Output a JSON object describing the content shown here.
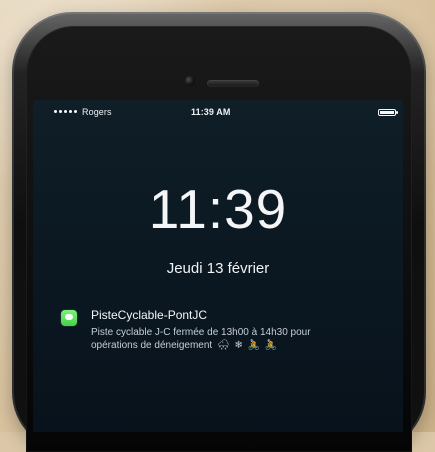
{
  "status_bar": {
    "carrier": "Rogers",
    "time": "11:39 AM"
  },
  "lock_screen": {
    "time": "11:39",
    "date": "Jeudi 13 février"
  },
  "notification": {
    "app_name": "PisteCyclable-PontJC",
    "line1": "Piste cyclable J-C fermée de 13h00 à 14h30 pour",
    "line2": "opérations de déneigement",
    "emojis": [
      "🌨",
      "❄",
      "🚴",
      "🚴"
    ]
  }
}
